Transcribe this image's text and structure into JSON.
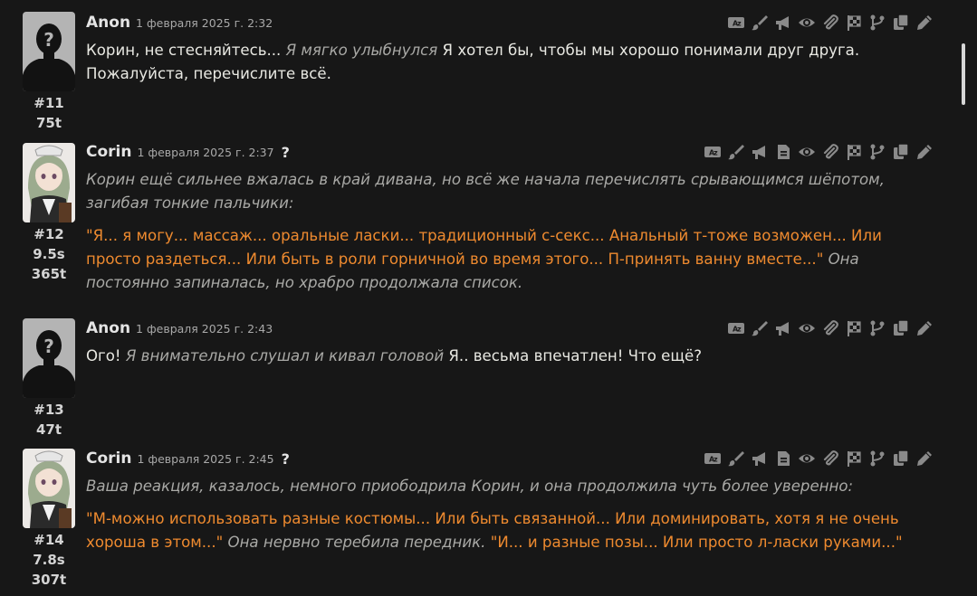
{
  "messages": [
    {
      "name": "Anon",
      "time": "1 февраля 2025 г. 2:32",
      "id": "#11",
      "tokens": "75t",
      "paras": [
        [
          {
            "t": "Корин, не стесняйтесь... ",
            "c": "n"
          },
          {
            "t": "Я мягко улыбнулся",
            "c": "i"
          },
          {
            "t": " Я хотел бы, чтобы мы хорошо понимали друг друга. Пожалуйста, перечислите всё.",
            "c": "n"
          }
        ]
      ]
    },
    {
      "name": "Corin",
      "time": "1 февраля 2025 г. 2:37",
      "q": "?",
      "id": "#12",
      "duration": "9.5s",
      "tokens": "365t",
      "paras": [
        [
          {
            "t": "Корин ещё сильнее вжалась в край дивана, но всё же начала перечислять срывающимся шёпотом, загибая тонкие пальчики:",
            "c": "i"
          }
        ],
        [
          {
            "t": "\"Я... я могу... массаж... оральные ласки... традиционный с-секс... Анальный т-тоже возможен... Или просто раздеться... Или быть в роли горничной во время этого... П-принять ванну вместе...\"",
            "c": "q"
          },
          {
            "t": " Она постоянно запиналась, но храбро продолжала список.",
            "c": "i"
          }
        ]
      ]
    },
    {
      "name": "Anon",
      "time": "1 февраля 2025 г. 2:43",
      "id": "#13",
      "tokens": "47t",
      "paras": [
        [
          {
            "t": "Ого! ",
            "c": "n"
          },
          {
            "t": "Я внимательно слушал и кивал головой",
            "c": "i"
          },
          {
            "t": " Я.. весьма впечатлен! Что ещё?",
            "c": "n"
          }
        ]
      ]
    },
    {
      "name": "Corin",
      "time": "1 февраля 2025 г. 2:45",
      "q": "?",
      "id": "#14",
      "duration": "7.8s",
      "tokens": "307t",
      "paras": [
        [
          {
            "t": "Ваша реакция, казалось, немного приободрила Корин, и она продолжила чуть более уверенно:",
            "c": "i"
          }
        ],
        [
          {
            "t": "\"М-можно использовать разные костюмы... Или быть связанной... Или доминировать, хотя я не очень хороша в этом...\"",
            "c": "q"
          },
          {
            "t": " Она нервно теребила передник. ",
            "c": "i"
          },
          {
            "t": "\"И... и разные позы... Или просто л-ласки руками...\"",
            "c": "q"
          }
        ]
      ]
    }
  ],
  "icons_user": [
    "translate-icon",
    "paintbrush-icon",
    "bullhorn-icon",
    "eye-icon",
    "paperclip-icon",
    "flag-checkered-icon",
    "branch-icon",
    "copy-icon",
    "pencil-icon"
  ],
  "icons_char": [
    "translate-icon",
    "paintbrush-icon",
    "bullhorn-icon",
    "file-lines-icon",
    "eye-icon",
    "paperclip-icon",
    "flag-checkered-icon",
    "branch-icon",
    "copy-icon",
    "pencil-icon"
  ],
  "colors": {
    "background": "#171717",
    "text": "#e8e8e2",
    "italic": "#a9a9a6",
    "quote": "#ee8a2f",
    "icon": "#8a8a8a"
  }
}
